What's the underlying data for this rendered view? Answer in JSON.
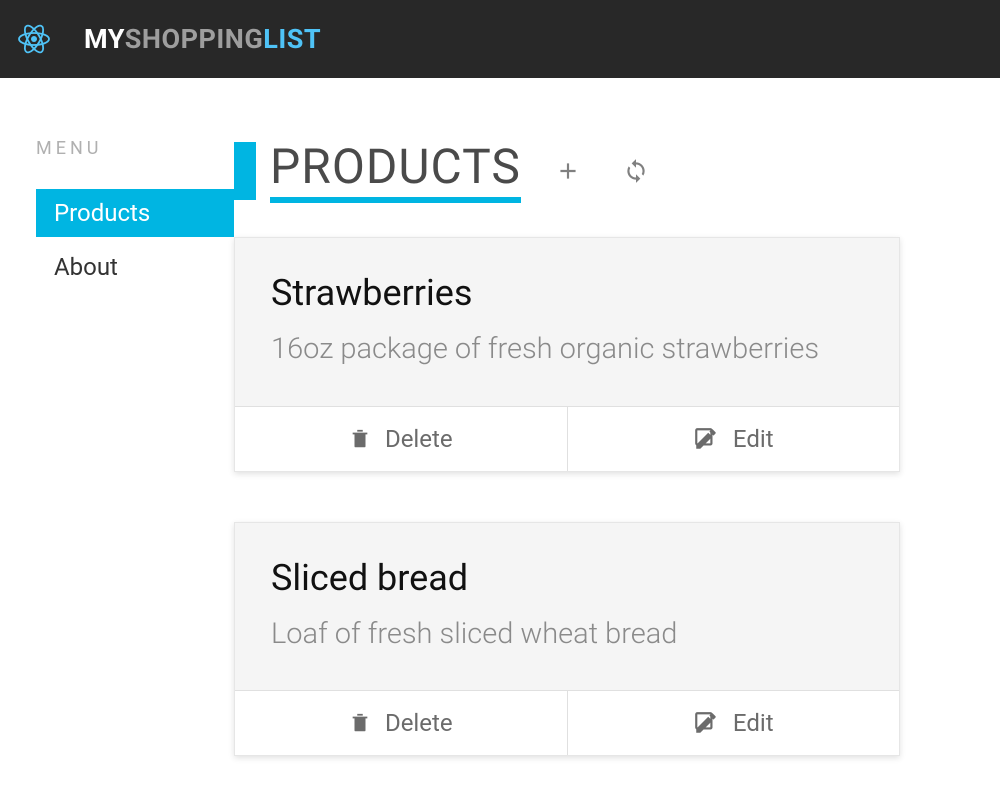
{
  "header": {
    "brand_my": "MY",
    "brand_shopping": "SHOPPING",
    "brand_list": "LIST"
  },
  "sidebar": {
    "menu_label": "MENU",
    "items": [
      {
        "label": "Products",
        "active": true
      },
      {
        "label": "About",
        "active": false
      }
    ]
  },
  "main": {
    "title": "PRODUCTS",
    "actions": {
      "add_label": "Add",
      "refresh_label": "Refresh"
    },
    "products": [
      {
        "name": "Strawberries",
        "description": "16oz package of fresh organic strawberries",
        "delete_label": "Delete",
        "edit_label": "Edit"
      },
      {
        "name": "Sliced bread",
        "description": "Loaf of fresh sliced wheat bread",
        "delete_label": "Delete",
        "edit_label": "Edit"
      }
    ]
  },
  "colors": {
    "accent": "#00b5e2",
    "header_bg": "#282828",
    "logo": "#4fc3f7"
  }
}
